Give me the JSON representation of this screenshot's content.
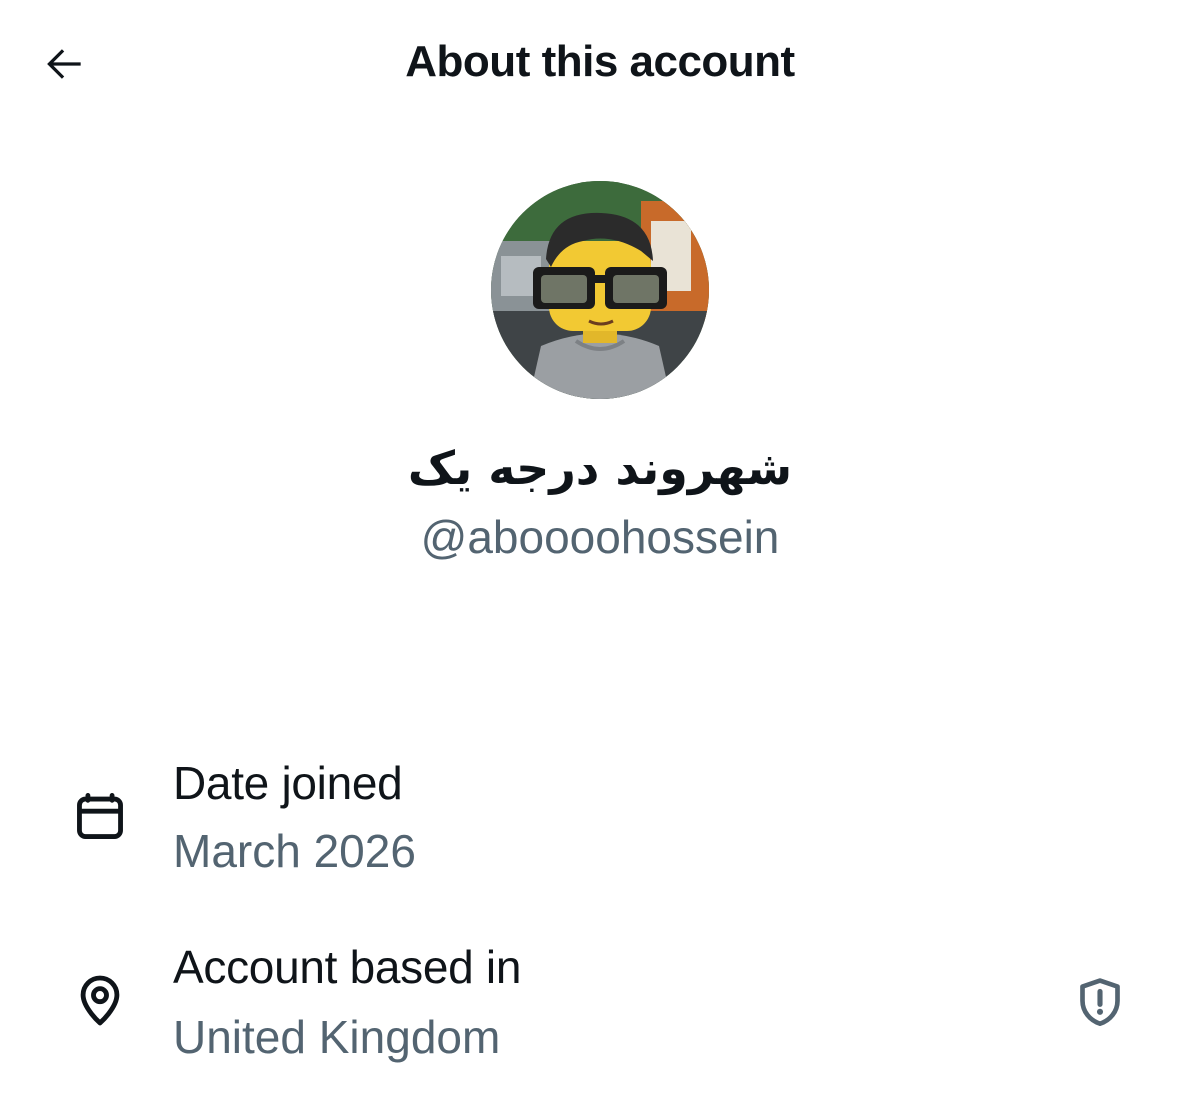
{
  "header": {
    "title": "About this account",
    "back_icon": "arrow-left-icon"
  },
  "profile": {
    "display_name": "شهروند درجه یک",
    "handle": "@aboooohossein",
    "avatar_description_icon": "avatar-image"
  },
  "details": [
    {
      "icon": "calendar-icon",
      "label": "Date joined",
      "value": "March 2026"
    },
    {
      "icon": "location-pin-icon",
      "label": "Account based in",
      "value": "United Kingdom",
      "trailing_icon": "shield-alert-icon"
    }
  ],
  "colors": {
    "text_primary": "#0f1419",
    "text_secondary": "#536471",
    "background": "#ffffff"
  }
}
